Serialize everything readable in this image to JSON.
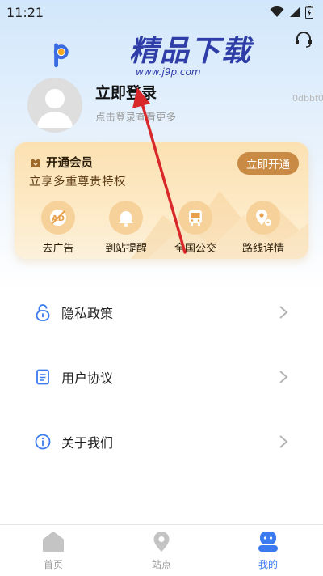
{
  "status_bar": {
    "time": "11:21"
  },
  "watermark": {
    "brand_text": "精品下载",
    "url_text": "www.j9p.com"
  },
  "profile": {
    "login_title": "立即登录",
    "login_subtitle": "点击登录查看更多",
    "user_id": "0dbbf0"
  },
  "vip_card": {
    "title": "开通会员",
    "subtitle": "立享多重尊贵特权",
    "open_button": "立即开通",
    "features": [
      {
        "label": "去广告",
        "icon": "no-ads-icon"
      },
      {
        "label": "到站提醒",
        "icon": "bell-icon"
      },
      {
        "label": "全国公交",
        "icon": "bus-icon"
      },
      {
        "label": "路线详情",
        "icon": "route-pin-icon"
      }
    ]
  },
  "menu": {
    "items": [
      {
        "label": "隐私政策",
        "icon": "lock-icon"
      },
      {
        "label": "用户协议",
        "icon": "document-icon"
      },
      {
        "label": "关于我们",
        "icon": "info-icon"
      }
    ]
  },
  "bottom_nav": {
    "tabs": [
      {
        "label": "首页",
        "icon": "home-icon",
        "active": false
      },
      {
        "label": "站点",
        "icon": "location-pin-icon",
        "active": false
      },
      {
        "label": "我的",
        "icon": "user-icon",
        "active": true
      }
    ]
  },
  "colors": {
    "accent_blue": "#3a7bf0",
    "vip_button": "#c88a44",
    "annotation_arrow": "#d8282a"
  }
}
